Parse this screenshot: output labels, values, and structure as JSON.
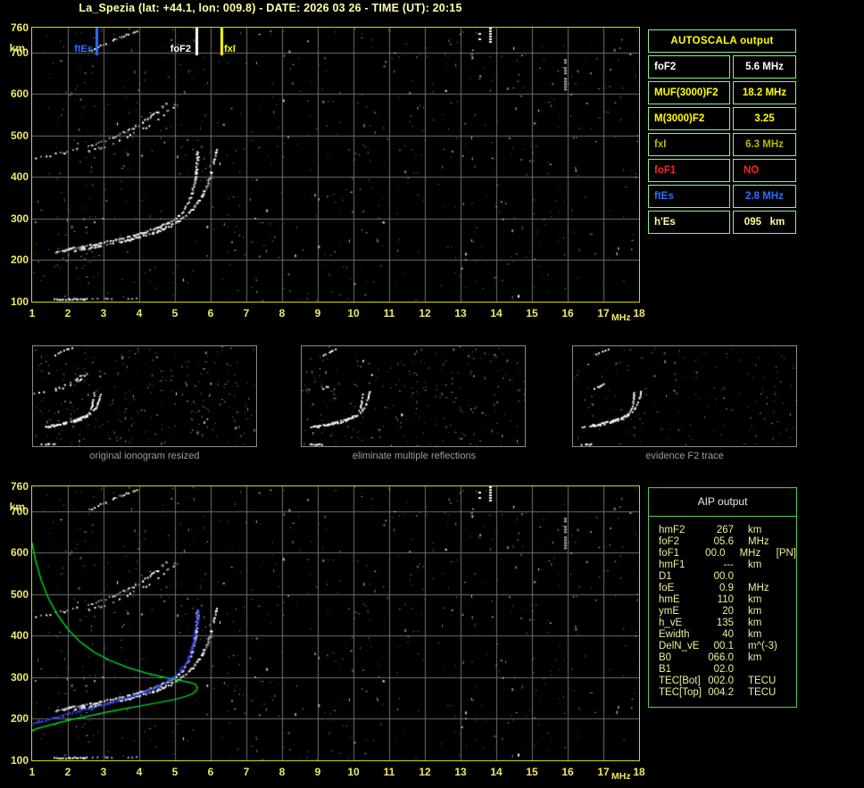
{
  "window": {
    "title": "La_Spezia (lat: +44.1, lon: 009.8) - DATE: 2026 03 26 - TIME (UT): 20:15",
    "background": "#000000"
  },
  "colors": {
    "plot_border": "#d6d600",
    "grid": "#6f6f6f",
    "axis_label": "#f0e868",
    "title": "#ffffa8",
    "trace": "#ffffff",
    "profile_green": "#00cc22",
    "fitted_blue": "#2a3cf0",
    "autoscala_border": "#90ee90",
    "aip_border": "#55cc55",
    "aip_text": "#efef9a",
    "caption_gray": "#9c9c9c"
  },
  "axes": {
    "x_ticks": [
      1,
      2,
      3,
      4,
      5,
      6,
      7,
      8,
      9,
      10,
      11,
      12,
      13,
      14,
      15,
      16,
      17,
      18
    ],
    "x_unit": "MHz",
    "y_ticks": [
      760,
      700,
      600,
      500,
      400,
      300,
      200,
      100
    ],
    "y_unit": "km",
    "xlim": [
      1,
      18
    ],
    "ylim": [
      100,
      760
    ]
  },
  "top_panel": {
    "markers": [
      {
        "label": "ftEs",
        "freq_mhz": 2.8,
        "color": "#2b6fff"
      },
      {
        "label": "foF2",
        "freq_mhz": 5.6,
        "color": "#ffffff"
      },
      {
        "label": "fxI",
        "freq_mhz": 6.3,
        "color": "#ffff00"
      }
    ]
  },
  "autoscala": {
    "title": "AUTOSCALA output",
    "rows": [
      {
        "label": "foF2",
        "value": "5.6 MHz",
        "color": "#ffffff",
        "align": "center"
      },
      {
        "label": "MUF(3000)F2",
        "value": "18.2 MHz",
        "color": "#ffff00",
        "align": "center"
      },
      {
        "label": "M(3000)F2",
        "value": "3.25",
        "color": "#ffff00",
        "align": "center"
      },
      {
        "label": "fxI",
        "value": "6.3 MHz",
        "color": "#b8b800",
        "align": "center"
      },
      {
        "label": "foF1",
        "value": "NO",
        "color": "#ff2222",
        "align": "left"
      },
      {
        "label": "ftEs",
        "value": "2.8 MHz",
        "color": "#2b6fff",
        "align": "center"
      },
      {
        "label": "h'Es",
        "value": "095   km",
        "color": "#ffff99",
        "align": "center"
      }
    ]
  },
  "aip": {
    "title": "AIP output",
    "rows": [
      {
        "label": "hmF2",
        "value": "267",
        "unit": "km",
        "extra": ""
      },
      {
        "label": "foF2",
        "value": "05.6",
        "unit": "MHz",
        "extra": ""
      },
      {
        "label": "foF1",
        "value": "00.0",
        "unit": "MHz",
        "extra": "[PN]"
      },
      {
        "label": "hmF1",
        "value": "---",
        "unit": "km",
        "extra": ""
      },
      {
        "label": "D1",
        "value": "00.0",
        "unit": "",
        "extra": ""
      },
      {
        "label": "foE",
        "value": "0.9",
        "unit": "MHz",
        "extra": ""
      },
      {
        "label": "hmE",
        "value": "110",
        "unit": "km",
        "extra": ""
      },
      {
        "label": "ymE",
        "value": "20",
        "unit": "km",
        "extra": ""
      },
      {
        "label": "h_vE",
        "value": "135",
        "unit": "km",
        "extra": ""
      },
      {
        "label": "Ewidth",
        "value": "40",
        "unit": "km",
        "extra": ""
      },
      {
        "label": "DelN_vE",
        "value": "00.1",
        "unit": "m^(-3)",
        "extra": ""
      },
      {
        "label": "B0",
        "value": "066.0",
        "unit": "km",
        "extra": ""
      },
      {
        "label": "B1",
        "value": "02.0",
        "unit": "",
        "extra": ""
      },
      {
        "label": "TEC[Bot]",
        "value": "002.0",
        "unit": "TECU",
        "extra": ""
      },
      {
        "label": "TEC[Top]",
        "value": "004.2",
        "unit": "TECU",
        "extra": ""
      }
    ]
  },
  "thumbnails": [
    {
      "caption": "original ionogram resized"
    },
    {
      "caption": "eliminate multiple reflections"
    },
    {
      "caption": "evidence F2 trace"
    }
  ],
  "chart_data": [
    {
      "type": "scatter",
      "title": "ionogram echoes (top plot, virtual height km vs frequency MHz)",
      "xlabel": "MHz",
      "ylabel": "km",
      "xlim": [
        1,
        18
      ],
      "ylim": [
        100,
        760
      ],
      "grid": true,
      "markers": [
        {
          "label": "ftEs",
          "x": 2.8
        },
        {
          "label": "foF2",
          "x": 5.6
        },
        {
          "label": "fxI",
          "x": 6.3
        }
      ],
      "series": [
        {
          "name": "Es-layer-trace-bright",
          "points": [
            [
              1.62,
              107
            ],
            [
              2.05,
              107.5
            ],
            [
              2.6,
              108
            ]
          ]
        },
        {
          "name": "Es-layer-trace-faint",
          "points": [
            [
              2.6,
              108
            ],
            [
              3.2,
              109
            ],
            [
              4.0,
              110
            ]
          ]
        },
        {
          "name": "F2-ordinary-trace",
          "points": [
            [
              1.62,
              220
            ],
            [
              1.8,
              224
            ],
            [
              2.0,
              228
            ],
            [
              2.2,
              231
            ],
            [
              2.4,
              234
            ],
            [
              2.6,
              238
            ],
            [
              2.8,
              241
            ],
            [
              3.0,
              245
            ],
            [
              3.2,
              249
            ],
            [
              3.4,
              253
            ],
            [
              3.6,
              257
            ],
            [
              3.8,
              261
            ],
            [
              4.0,
              266
            ],
            [
              4.2,
              271
            ],
            [
              4.4,
              277
            ],
            [
              4.6,
              284
            ],
            [
              4.8,
              292
            ],
            [
              4.95,
              300
            ],
            [
              5.1,
              310
            ],
            [
              5.2,
              320
            ],
            [
              5.3,
              333
            ],
            [
              5.38,
              348
            ],
            [
              5.45,
              365
            ],
            [
              5.5,
              385
            ],
            [
              5.55,
              408
            ],
            [
              5.58,
              432
            ],
            [
              5.6,
              455
            ],
            [
              5.61,
              472
            ]
          ]
        },
        {
          "name": "F2-extraordinary-trace",
          "points": [
            [
              2.15,
              224
            ],
            [
              2.4,
              228
            ],
            [
              2.7,
              233
            ],
            [
              3.0,
              238
            ],
            [
              3.3,
              243
            ],
            [
              3.6,
              249
            ],
            [
              3.9,
              255
            ],
            [
              4.2,
              262
            ],
            [
              4.5,
              271
            ],
            [
              4.75,
              280
            ],
            [
              5.0,
              291
            ],
            [
              5.2,
              303
            ],
            [
              5.4,
              318
            ],
            [
              5.55,
              333
            ],
            [
              5.7,
              350
            ],
            [
              5.82,
              370
            ],
            [
              5.92,
              392
            ],
            [
              6.0,
              415
            ],
            [
              6.07,
              438
            ],
            [
              6.12,
              458
            ],
            [
              6.15,
              472
            ]
          ]
        },
        {
          "name": "second-hop-ordinary",
          "points": [
            [
              1.05,
              447
            ],
            [
              1.3,
              451
            ],
            [
              1.6,
              456
            ],
            [
              1.9,
              461
            ],
            [
              2.2,
              468
            ],
            [
              2.5,
              475
            ],
            [
              2.8,
              483
            ],
            [
              3.1,
              492
            ],
            [
              3.4,
              503
            ],
            [
              3.7,
              515
            ],
            [
              3.95,
              527
            ],
            [
              4.2,
              541
            ],
            [
              4.45,
              557
            ],
            [
              4.65,
              572
            ],
            [
              4.8,
              585
            ]
          ]
        },
        {
          "name": "second-hop-extraordinary",
          "points": [
            [
              2.55,
              463
            ],
            [
              2.9,
              472
            ],
            [
              3.25,
              483
            ],
            [
              3.6,
              496
            ],
            [
              3.95,
              511
            ],
            [
              4.3,
              528
            ],
            [
              4.6,
              547
            ],
            [
              4.85,
              565
            ],
            [
              5.05,
              581
            ]
          ]
        },
        {
          "name": "oblique-streak-topside",
          "points": [
            [
              2.6,
              705
            ],
            [
              2.9,
              718
            ],
            [
              3.2,
              730
            ],
            [
              3.55,
              742
            ],
            [
              3.9,
              752
            ],
            [
              4.1,
              758
            ]
          ]
        },
        {
          "name": "under-trace-scatter",
          "dots": [
            [
              1.85,
              205
            ],
            [
              2.0,
              213
            ],
            [
              2.15,
              221
            ],
            [
              2.35,
              210
            ],
            [
              2.5,
              216
            ],
            [
              2.65,
              222
            ],
            [
              2.85,
              212
            ],
            [
              1.95,
              199
            ],
            [
              2.2,
              226
            ],
            [
              2.45,
              204
            ]
          ]
        }
      ],
      "rfi_bars": [
        {
          "f": 13.52,
          "km": [
            732,
            760
          ],
          "color": "#ffffff"
        },
        {
          "f": 13.82,
          "km": [
            726,
            760
          ],
          "color": "#ffffff"
        },
        {
          "f": 15.92,
          "km": [
            612,
            684
          ],
          "color": "#b5b5b5"
        }
      ],
      "noise": {
        "seed": 1337,
        "dots": 780,
        "brightness": 1.0
      }
    },
    {
      "type": "line",
      "title": "AIP restored profile over same ionogram echoes (bottom plot)",
      "xlabel": "MHz",
      "ylabel": "km",
      "xlim": [
        1,
        18
      ],
      "ylim": [
        100,
        760
      ],
      "grid": true,
      "includes_series_from": "chart_data.0",
      "series": [
        {
          "name": "electron-density-profile-green",
          "points": [
            [
              0.7,
              148
            ],
            [
              0.8,
              160
            ],
            [
              0.95,
              170
            ],
            [
              1.15,
              177
            ],
            [
              1.45,
              184
            ],
            [
              1.8,
              192
            ],
            [
              2.2,
              200
            ],
            [
              2.65,
              208
            ],
            [
              3.15,
              217
            ],
            [
              3.65,
              225
            ],
            [
              4.15,
              233
            ],
            [
              4.6,
              240
            ],
            [
              5.0,
              247
            ],
            [
              5.3,
              254
            ],
            [
              5.5,
              261
            ],
            [
              5.6,
              268
            ],
            [
              5.63,
              275
            ],
            [
              5.58,
              283
            ],
            [
              5.4,
              288
            ],
            [
              5.1,
              293
            ],
            [
              4.7,
              300
            ],
            [
              4.2,
              310
            ],
            [
              3.7,
              323
            ],
            [
              3.2,
              340
            ],
            [
              2.75,
              360
            ],
            [
              2.35,
              385
            ],
            [
              2.0,
              416
            ],
            [
              1.7,
              452
            ],
            [
              1.45,
              492
            ],
            [
              1.25,
              535
            ],
            [
              1.1,
              580
            ],
            [
              1.0,
              624
            ]
          ]
        },
        {
          "name": "fitted-F2-trace-blue",
          "points": [
            [
              1.0,
              190
            ],
            [
              1.3,
              197
            ],
            [
              1.6,
              204
            ],
            [
              1.9,
              211
            ],
            [
              2.2,
              218
            ],
            [
              2.5,
              225
            ],
            [
              2.8,
              231
            ],
            [
              3.1,
              238
            ],
            [
              3.4,
              246
            ],
            [
              3.7,
              254
            ],
            [
              4.0,
              262
            ],
            [
              4.3,
              272
            ],
            [
              4.55,
              282
            ],
            [
              4.8,
              294
            ],
            [
              5.0,
              307
            ],
            [
              5.15,
              321
            ],
            [
              5.3,
              339
            ],
            [
              5.4,
              358
            ],
            [
              5.48,
              380
            ],
            [
              5.54,
              405
            ],
            [
              5.58,
              430
            ],
            [
              5.6,
              452
            ],
            [
              5.61,
              470
            ]
          ]
        }
      ],
      "noise": {
        "seed": 1337,
        "dots": 780,
        "brightness": 1.0
      }
    },
    {
      "type": "scatter",
      "title": "processing thumbnails (same traces rescaled)",
      "thumb_hop2_fragment": [
        [
          2.6,
          480
        ],
        [
          3.4,
          515
        ]
      ],
      "noise": [
        {
          "seed": 21,
          "dots": 300,
          "brightness": 0.9
        },
        {
          "seed": 22,
          "dots": 260,
          "brightness": 0.8
        },
        {
          "seed": 23,
          "dots": 170,
          "brightness": 0.6
        }
      ]
    }
  ]
}
